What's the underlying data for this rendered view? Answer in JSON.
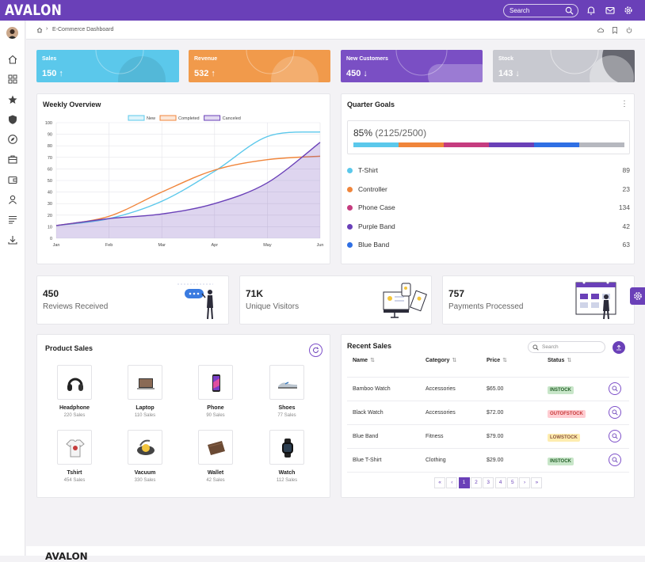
{
  "app": {
    "logo": "AVALON",
    "search_placeholder": "Search"
  },
  "breadcrumb": {
    "page": "E-Commerce Dashboard"
  },
  "kpis": [
    {
      "label": "Sales",
      "value": "150 ↑",
      "color": "#5bc8eb"
    },
    {
      "label": "Revenue",
      "value": "532 ↑",
      "color": "#f19a4b"
    },
    {
      "label": "New Customers",
      "value": "450 ↓",
      "color": "#7a4fc4"
    },
    {
      "label": "Stock",
      "value": "143 ↓",
      "color": "#c8c9d0"
    }
  ],
  "weekly": {
    "title": "Weekly Overview",
    "chart_data": {
      "type": "line",
      "categories": [
        "Jan",
        "Feb",
        "Mar",
        "Apr",
        "May",
        "Jun"
      ],
      "ylim": [
        0,
        100
      ],
      "yticks": [
        0,
        10,
        20,
        30,
        40,
        50,
        60,
        70,
        80,
        90,
        100
      ],
      "legend": "top-center",
      "series": [
        {
          "name": "New",
          "color": "#5bc8eb",
          "values": [
            11,
            17,
            32,
            58,
            88,
            92
          ]
        },
        {
          "name": "Completed",
          "color": "#f0853b",
          "values": [
            11,
            19,
            40,
            59,
            68,
            71
          ]
        },
        {
          "name": "Canceled",
          "color": "#6a40b8",
          "values": [
            11,
            17,
            21,
            30,
            48,
            83
          ]
        }
      ]
    }
  },
  "goals": {
    "title": "Quarter Goals",
    "pct": "85%",
    "count": "(2125/2500)",
    "segments": [
      "#5bc8eb",
      "#f0853b",
      "#c53c7f",
      "#6a40b8",
      "#2f6fe4",
      "#b6b8bf"
    ],
    "items": [
      {
        "name": "T-Shirt",
        "value": "89",
        "color": "#5bc8eb"
      },
      {
        "name": "Controller",
        "value": "23",
        "color": "#f0853b"
      },
      {
        "name": "Phone Case",
        "value": "134",
        "color": "#c53c7f"
      },
      {
        "name": "Purple Band",
        "value": "42",
        "color": "#6a40b8"
      },
      {
        "name": "Blue Band",
        "value": "63",
        "color": "#2f6fe4"
      }
    ]
  },
  "stats": [
    {
      "value": "450",
      "label": "Reviews Received"
    },
    {
      "value": "71K",
      "label": "Unique Visitors"
    },
    {
      "value": "757",
      "label": "Payments Processed"
    }
  ],
  "products": {
    "title": "Product Sales",
    "items": [
      {
        "name": "Headphone",
        "sales": "220 Sales",
        "icon": "headphone-icon"
      },
      {
        "name": "Laptop",
        "sales": "110 Sales",
        "icon": "laptop-icon"
      },
      {
        "name": "Phone",
        "sales": "90 Sales",
        "icon": "phone-icon"
      },
      {
        "name": "Shoes",
        "sales": "77 Sales",
        "icon": "shoes-icon"
      },
      {
        "name": "Tshirt",
        "sales": "454 Sales",
        "icon": "tshirt-icon"
      },
      {
        "name": "Vacuum",
        "sales": "330 Sales",
        "icon": "vacuum-icon"
      },
      {
        "name": "Wallet",
        "sales": "42 Sales",
        "icon": "wallet-icon"
      },
      {
        "name": "Watch",
        "sales": "112 Sales",
        "icon": "watch-icon"
      }
    ]
  },
  "recent": {
    "title": "Recent Sales",
    "search_placeholder": "Search",
    "headers": [
      "Name",
      "Category",
      "Price",
      "Status"
    ],
    "rows": [
      {
        "name": "Bamboo Watch",
        "category": "Accessories",
        "price": "$65.00",
        "status": "INSTOCK"
      },
      {
        "name": "Black Watch",
        "category": "Accessories",
        "price": "$72.00",
        "status": "OUTOFSTOCK"
      },
      {
        "name": "Blue Band",
        "category": "Fitness",
        "price": "$79.00",
        "status": "LOWSTOCK"
      },
      {
        "name": "Blue T-Shirt",
        "category": "Clothing",
        "price": "$29.00",
        "status": "INSTOCK"
      }
    ],
    "pages": [
      "«",
      "‹",
      "1",
      "2",
      "3",
      "4",
      "5",
      "›",
      "»"
    ],
    "current_page": "1"
  },
  "footer": {
    "logo": "AVALON"
  }
}
